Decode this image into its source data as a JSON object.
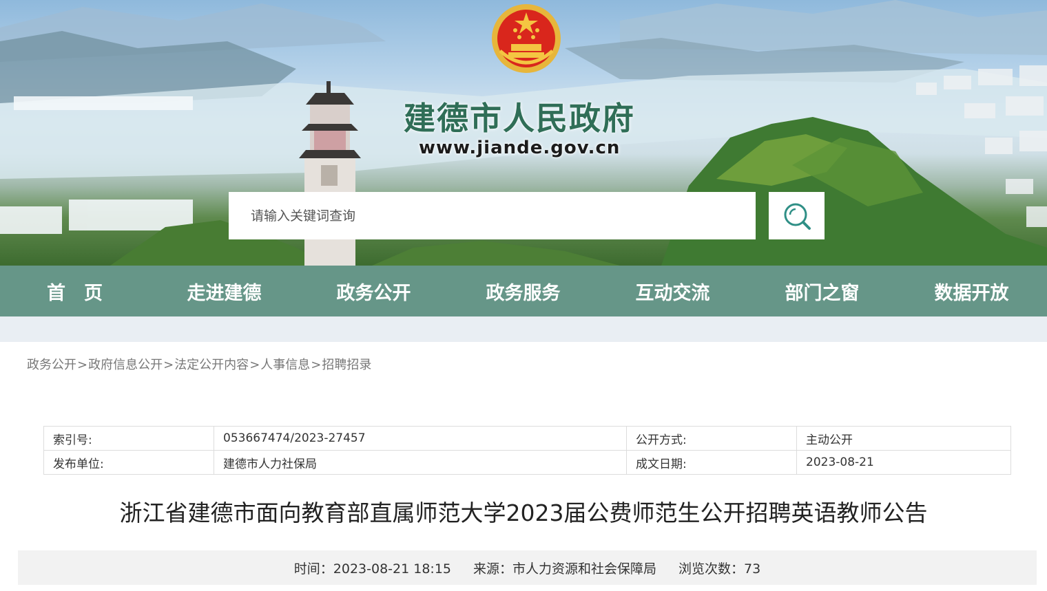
{
  "header": {
    "site_title": "建德市人民政府",
    "site_url": "www.jiande.gov.cn",
    "search": {
      "placeholder": "请输入关键词查询"
    },
    "emblem_icon": "national-emblem-icon",
    "search_icon": "search-icon"
  },
  "nav": {
    "items": [
      {
        "label": "首　页"
      },
      {
        "label": "走进建德"
      },
      {
        "label": "政务公开"
      },
      {
        "label": "政务服务"
      },
      {
        "label": "互动交流"
      },
      {
        "label": "部门之窗"
      },
      {
        "label": "数据开放"
      }
    ]
  },
  "breadcrumb": {
    "separator": ">",
    "items": [
      "政务公开",
      "政府信息公开",
      "法定公开内容",
      "人事信息",
      "招聘招录"
    ]
  },
  "meta": {
    "index_label": "索引号:",
    "index_value": "053667474/2023-27457",
    "method_label": "公开方式:",
    "method_value": "主动公开",
    "publisher_label": "发布单位:",
    "publisher_value": "建德市人力社保局",
    "date_label": "成文日期:",
    "date_value": "2023-08-21"
  },
  "article": {
    "title": "浙江省建德市面向教育部直属师范大学2023届公费师范生公开招聘英语教师公告",
    "time_label": "时间：",
    "time_value": "2023-08-21 18:15",
    "source_label": "来源：",
    "source_value": "市人力资源和社会保障局",
    "views_label": "浏览次数：",
    "views_value": "73"
  },
  "colors": {
    "nav_bg": "#669688",
    "title_green": "#2f6e57",
    "page_bg": "#e9eef3"
  }
}
